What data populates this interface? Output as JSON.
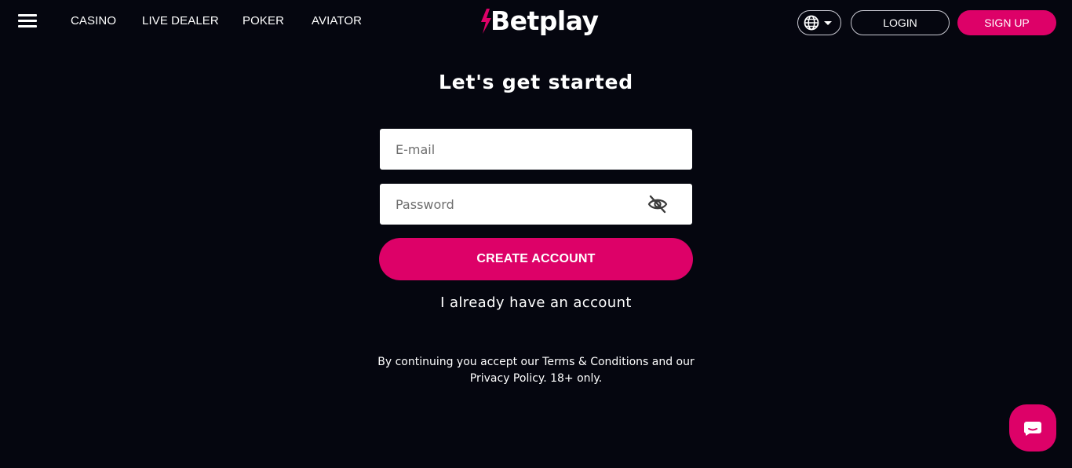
{
  "header": {
    "nav": [
      "CASINO",
      "LIVE DEALER",
      "POKER",
      "AVIATOR"
    ],
    "logo_text": "Betplay",
    "login_label": "LOGIN",
    "signup_label": "SIGN UP"
  },
  "form": {
    "title": "Let's get started",
    "email_placeholder": "E-mail",
    "password_placeholder": "Password",
    "create_label": "CREATE ACCOUNT",
    "already_label": "I already have an account",
    "terms_line1": "By continuing you accept our Terms & Conditions and our",
    "terms_line2": "Privacy Policy. 18+ only."
  },
  "icons": {
    "menu": "hamburger-menu-icon",
    "language": "globe-icon",
    "password_toggle": "eye-slash-icon",
    "chat": "chat-bubble-icon"
  },
  "colors": {
    "background": "#05060f",
    "accent": "#dd0168"
  }
}
